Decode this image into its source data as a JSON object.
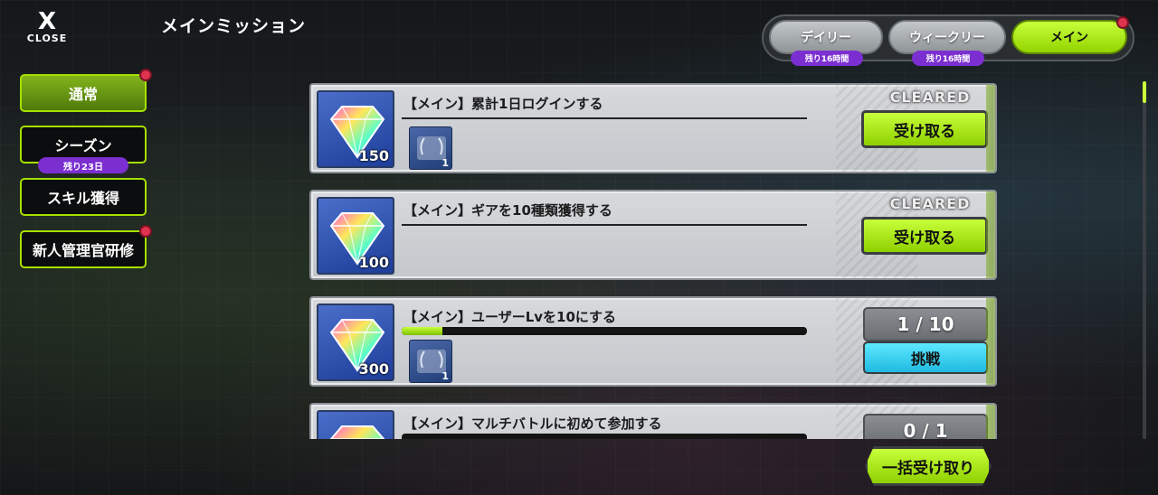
{
  "close": {
    "label": "CLOSE",
    "icon": "close-x-icon"
  },
  "title": "メインミッション",
  "tabs": [
    {
      "label": "デイリー",
      "badge": "残り16時間",
      "active": false
    },
    {
      "label": "ウィークリー",
      "badge": "残り16時間",
      "active": false
    },
    {
      "label": "メイン",
      "active": true,
      "notification": true
    }
  ],
  "sidebar": {
    "items": [
      {
        "label": "通常",
        "active": true,
        "notification": true
      },
      {
        "label": "シーズン",
        "badge": "残り23日"
      },
      {
        "label": "スキル獲得"
      },
      {
        "label": "新人管理官研修",
        "notification": true
      }
    ]
  },
  "missions": [
    {
      "text": "【メイン】累計1日ログインする",
      "reward_amount": "150",
      "sub_item_count": "1",
      "status": "CLEARED",
      "button": "受け取る"
    },
    {
      "text": "【メイン】ギアを10種類獲得する",
      "reward_amount": "100",
      "status": "CLEARED",
      "button": "受け取る"
    },
    {
      "text": "【メイン】ユーザーLvを10にする",
      "reward_amount": "300",
      "sub_item_count": "1",
      "progress": "1 / 10",
      "progress_fraction": 0.1,
      "button": "挑戦"
    },
    {
      "text": "【メイン】マルチバトルに初めて参加する",
      "progress": "0 / 1",
      "progress_fraction": 0
    }
  ],
  "bulk_receive": "一括受け取り",
  "colors": {
    "accent_green": "#a6e000",
    "badge_purple": "#7b2fd0",
    "challenge_cyan": "#2fc9ee",
    "notification_red": "#e0334f"
  }
}
